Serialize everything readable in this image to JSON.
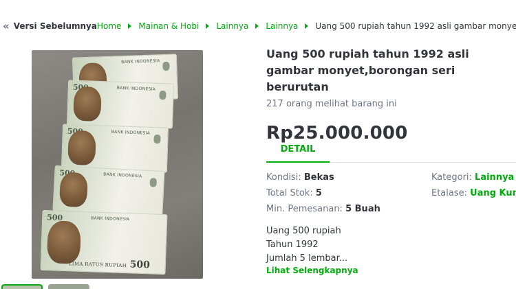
{
  "breadcrumb": {
    "back_label": "Versi Sebelumnya",
    "items": [
      "Home",
      "Mainan & Hobi",
      "Lainnya",
      "Lainnya"
    ],
    "current": "Uang 500 rupiah tahun 1992 asli gambar monyet,..."
  },
  "photo": {
    "notes": [
      {
        "num": "500",
        "bank": "BANK INDONESIA"
      },
      {
        "num": "500",
        "bank": "BANK INDONESIA"
      },
      {
        "num": "500",
        "bank": "BANK INDONESIA"
      },
      {
        "num": "500",
        "bank": "BANK INDONESIA"
      },
      {
        "num": "500",
        "bank": "BANK INDONESIA",
        "text": "LIMA RATUS RUPIAH",
        "value": "500"
      }
    ]
  },
  "product": {
    "title": "Uang 500 rupiah tahun 1992 asli gambar monyet,borongan seri berurutan",
    "views": "217 orang melihat barang ini",
    "price": "Rp25.000.000"
  },
  "tabs": {
    "detail": "DETAIL"
  },
  "specs": {
    "kondisi_label": "Kondisi: ",
    "kondisi_value": "Bekas",
    "stok_label": "Total Stok: ",
    "stok_value": "5",
    "min_label": "Min. Pemesanan: ",
    "min_value": "5 Buah",
    "kategori_label": "Kategori: ",
    "kategori_value": "Lainnya",
    "etalase_label": "Etalase: ",
    "etalase_value": "Uang Kuno"
  },
  "description": {
    "line1": "Uang 500 rupiah",
    "line2": "Tahun 1992",
    "line3": "Jumlah 5 lembar...",
    "more": "Lihat Selengkapnya"
  },
  "colors": {
    "accent": "#03ac0e",
    "text": "#31353b",
    "muted": "#6d7588"
  }
}
